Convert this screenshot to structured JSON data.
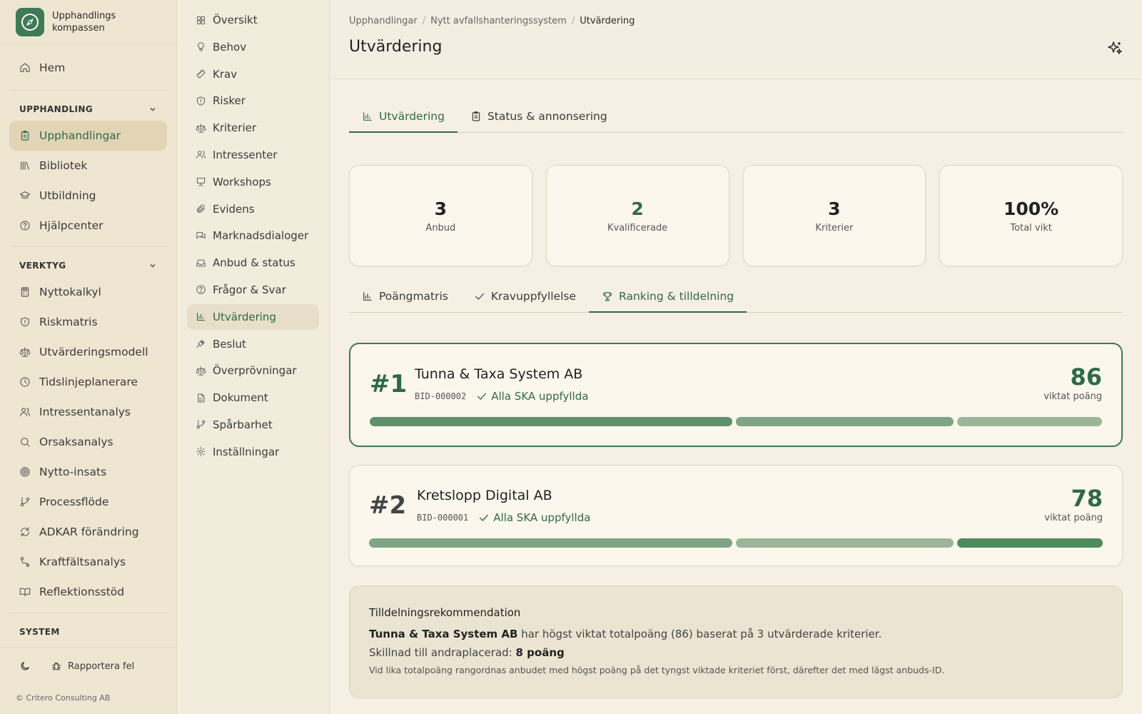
{
  "brand": {
    "name": "Upphandlings kompassen"
  },
  "sidebar": {
    "home": "Hem",
    "sections": [
      {
        "title": "UPPHANDLING",
        "items": [
          "Upphandlingar",
          "Bibliotek",
          "Utbildning",
          "Hjälpcenter"
        ]
      },
      {
        "title": "VERKTYG",
        "items": [
          "Nyttokalkyl",
          "Riskmatris",
          "Utvärderingsmodell",
          "Tidslinjeplanerare",
          "Intressentanalys",
          "Orsaksanalys",
          "Nytto-insats",
          "Processflöde",
          "ADKAR förändring",
          "Kraftfältsanalys",
          "Reflektionsstöd"
        ]
      },
      {
        "title": "SYSTEM"
      }
    ],
    "report_bug": "Rapportera fel",
    "copyright": "© Critero Consulting AB"
  },
  "subnav": [
    "Översikt",
    "Behov",
    "Krav",
    "Risker",
    "Kriterier",
    "Intressenter",
    "Workshops",
    "Evidens",
    "Marknadsdialoger",
    "Anbud & status",
    "Frågor & Svar",
    "Utvärdering",
    "Beslut",
    "Överprövningar",
    "Dokument",
    "Spårbarhet",
    "Inställningar"
  ],
  "breadcrumb": [
    "Upphandlingar",
    "Nytt avfallshanteringssystem",
    "Utvärdering"
  ],
  "page_title": "Utvärdering",
  "tabs": [
    "Utvärdering",
    "Status & annonsering"
  ],
  "stats": [
    {
      "value": "3",
      "label": "Anbud"
    },
    {
      "value": "2",
      "label": "Kvalificerade"
    },
    {
      "value": "3",
      "label": "Kriterier"
    },
    {
      "value": "100%",
      "label": "Total vikt"
    }
  ],
  "subtabs": [
    "Poängmatris",
    "Kravuppfyllelse",
    "Ranking & tilldelning"
  ],
  "ranking": [
    {
      "pos": "#1",
      "name": "Tunna & Taxa System AB",
      "bid": "BID-000002",
      "ska": "Alla SKA uppfyllda",
      "score": "86",
      "score_label": "viktat poäng"
    },
    {
      "pos": "#2",
      "name": "Kretslopp Digital AB",
      "bid": "BID-000001",
      "ska": "Alla SKA uppfyllda",
      "score": "78",
      "score_label": "viktat poäng"
    }
  ],
  "recommendation": {
    "title": "Tilldelningsrekommendation",
    "winner": "Tunna & Taxa System AB",
    "line1_rest": " har högst viktat totalpoäng (86) baserat på 3 utvärderade kriterier.",
    "line2_prefix": "Skillnad till andraplacerad: ",
    "line2_value": "8 poäng",
    "note": "Vid lika totalpoäng rangordnas anbudet med högst poäng på det tyngst viktade kriteriet först, därefter det med lägst anbuds-ID."
  },
  "colors": {
    "accent": "#2f6a45",
    "bar_dark": "#5f8f6b",
    "bar_mid": "#7fa585",
    "bar_light": "#9db69a"
  }
}
